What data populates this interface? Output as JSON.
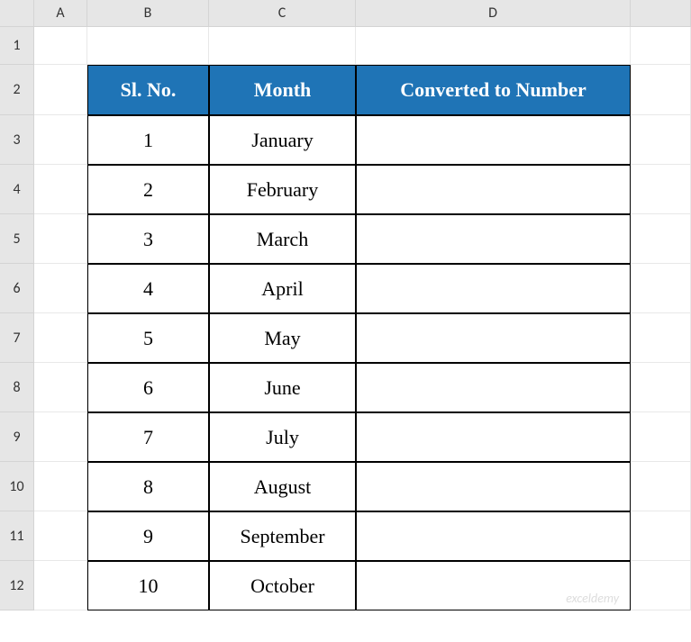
{
  "columns": [
    "A",
    "B",
    "C",
    "D",
    ""
  ],
  "rows": [
    "1",
    "2",
    "3",
    "4",
    "5",
    "6",
    "7",
    "8",
    "9",
    "10",
    "11",
    "12"
  ],
  "table": {
    "headers": {
      "sl_no": "Sl. No.",
      "month": "Month",
      "converted": "Converted to Number"
    },
    "data": [
      {
        "sl_no": "1",
        "month": "January",
        "converted": ""
      },
      {
        "sl_no": "2",
        "month": "February",
        "converted": ""
      },
      {
        "sl_no": "3",
        "month": "March",
        "converted": ""
      },
      {
        "sl_no": "4",
        "month": "April",
        "converted": ""
      },
      {
        "sl_no": "5",
        "month": "May",
        "converted": ""
      },
      {
        "sl_no": "6",
        "month": "June",
        "converted": ""
      },
      {
        "sl_no": "7",
        "month": "July",
        "converted": ""
      },
      {
        "sl_no": "8",
        "month": "August",
        "converted": ""
      },
      {
        "sl_no": "9",
        "month": "September",
        "converted": ""
      },
      {
        "sl_no": "10",
        "month": "October",
        "converted": ""
      }
    ]
  },
  "watermark": "exceldemy"
}
